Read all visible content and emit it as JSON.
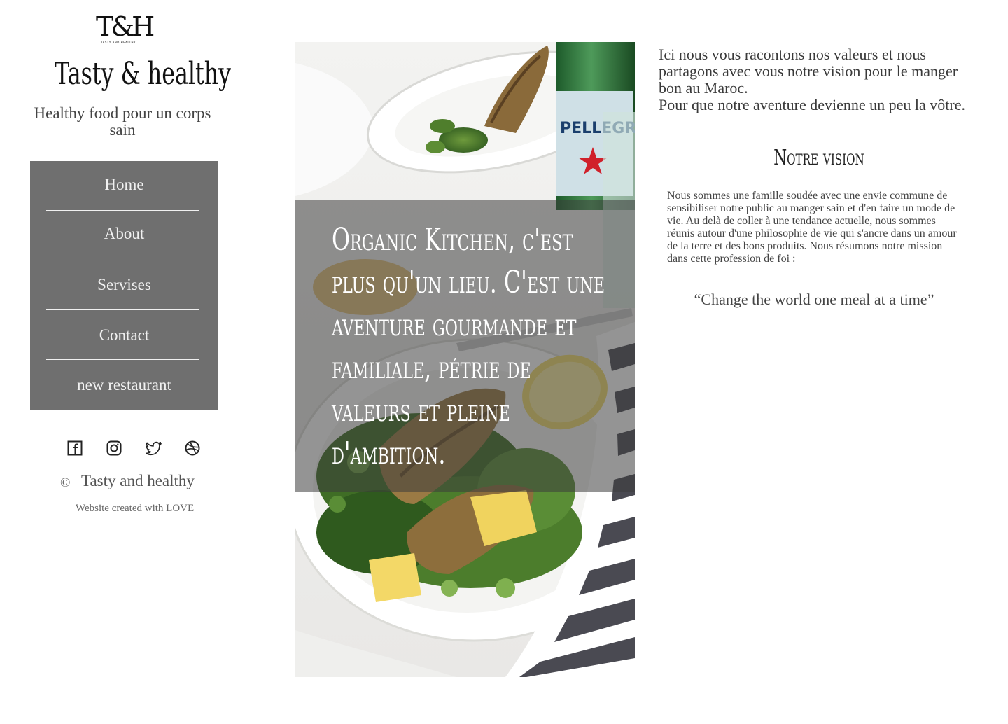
{
  "logo": {
    "monogram": "T&H",
    "tiny_text": "TASTY AND HEALTHY"
  },
  "brand": {
    "title": "Tasty & healthy",
    "tagline": "Healthy food pour un corps sain"
  },
  "nav": {
    "items": [
      {
        "label": "Home"
      },
      {
        "label": "About"
      },
      {
        "label": "Servises"
      },
      {
        "label": "Contact"
      },
      {
        "label": "new restaurant"
      }
    ]
  },
  "socials": [
    "facebook-icon",
    "instagram-icon",
    "twitter-icon",
    "dribbble-icon"
  ],
  "footer": {
    "copyright_symbol": "©",
    "copyright_text": "Tasty and healthy",
    "credit": "Website created with LOVE"
  },
  "hero": {
    "overlay_text": "Organic Kitchen, c'est plus qu'un lieu. C'est une aventure gourmande et familiale, pétrie de valeurs et pleine d'ambition."
  },
  "content": {
    "intro_line1": "Ici nous vous racontons nos valeurs et nous partagons avec vous notre vision pour le manger bon au Maroc.",
    "intro_line2": "Pour que notre aventure devienne un peu la vôtre.",
    "vision_title": "Notre vision",
    "vision_body": "Nous sommes une famille soudée avec une envie commune de sensibiliser notre public au manger sain et d'en faire un mode de vie. Au delà de coller à une tendance actuelle, nous sommes réunis autour d'une philosophie de vie qui s'ancre dans un amour de la terre et des bons produits. Nous résumons notre mission dans cette profession de foi :",
    "quote": "“Change the world one meal at a time”"
  },
  "colors": {
    "nav_background": "#6f6f6f",
    "nav_text": "#f1f1f1",
    "overlay": "rgba(60,60,60,0.55)"
  }
}
